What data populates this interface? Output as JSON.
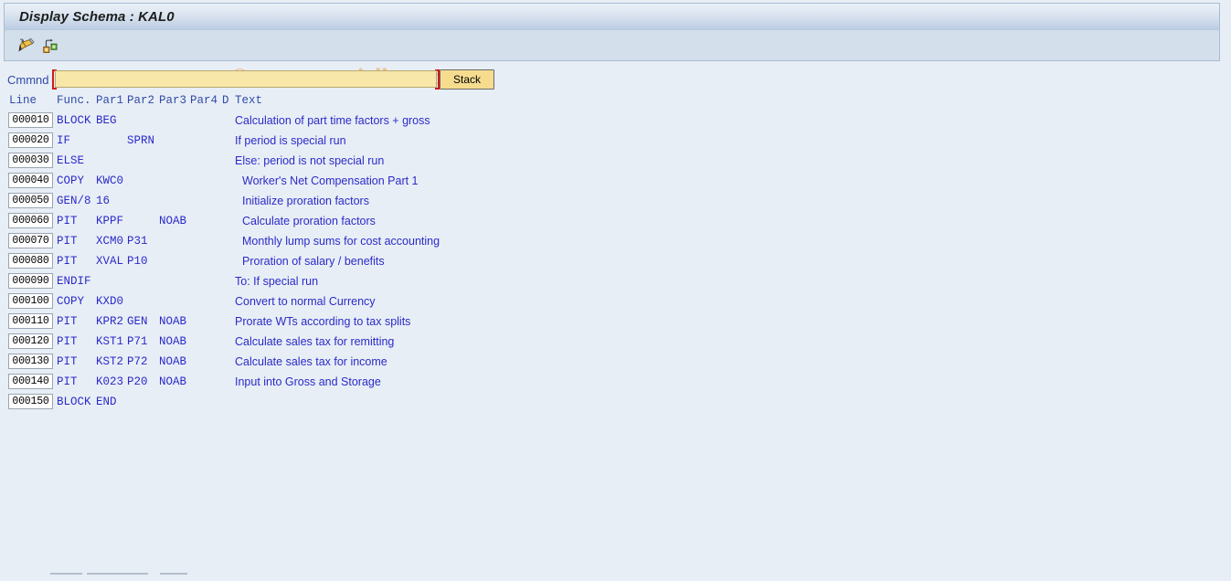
{
  "window": {
    "title": "Display Schema : KAL0"
  },
  "toolbar": {
    "buttons": [
      {
        "name": "edit-icon",
        "tooltip": "Change"
      },
      {
        "name": "structure-icon",
        "tooltip": "Structure"
      }
    ]
  },
  "watermark": {
    "text": "© www.tutorialkart.com",
    "color": "#eec192"
  },
  "command": {
    "label": "Cmmnd",
    "value": "",
    "placeholder": "",
    "stack_label": "Stack"
  },
  "table": {
    "headers": {
      "line": "Line",
      "func": "Func.",
      "par1": "Par1",
      "par2": "Par2",
      "par3": "Par3",
      "par4": "Par4",
      "d": "D",
      "text": "Text"
    },
    "rows": [
      {
        "line": "000010",
        "func": "BLOCK",
        "par1": "BEG",
        "par2": "",
        "par3": "",
        "par4": "",
        "d": "",
        "text": "Calculation of part time factors + gross",
        "indent": 0
      },
      {
        "line": "000020",
        "func": "IF",
        "par1": "",
        "par2": "SPRN",
        "par3": "",
        "par4": "",
        "d": "",
        "text": "If period is special run",
        "indent": 0
      },
      {
        "line": "000030",
        "func": "ELSE",
        "par1": "",
        "par2": "",
        "par3": "",
        "par4": "",
        "d": "",
        "text": "Else: period is not special run",
        "indent": 0
      },
      {
        "line": "000040",
        "func": "COPY",
        "par1": "KWC0",
        "par2": "",
        "par3": "",
        "par4": "",
        "d": "",
        "text": "Worker's Net Compensation Part 1",
        "indent": 1
      },
      {
        "line": "000050",
        "func": "GEN/8",
        "par1": "16",
        "par2": "",
        "par3": "",
        "par4": "",
        "d": "",
        "text": "Initialize proration factors",
        "indent": 1
      },
      {
        "line": "000060",
        "func": "PIT",
        "par1": "KPPF",
        "par2": "",
        "par3": "NOAB",
        "par4": "",
        "d": "",
        "text": "Calculate proration factors",
        "indent": 1
      },
      {
        "line": "000070",
        "func": "PIT",
        "par1": "XCM0",
        "par2": "P31",
        "par3": "",
        "par4": "",
        "d": "",
        "text": "Monthly lump sums for cost accounting",
        "indent": 1
      },
      {
        "line": "000080",
        "func": "PIT",
        "par1": "XVAL",
        "par2": "P10",
        "par3": "",
        "par4": "",
        "d": "",
        "text": "Proration of salary / benefits",
        "indent": 1
      },
      {
        "line": "000090",
        "func": "ENDIF",
        "par1": "",
        "par2": "",
        "par3": "",
        "par4": "",
        "d": "",
        "text": "To: If special run",
        "indent": 0
      },
      {
        "line": "000100",
        "func": "COPY",
        "par1": "KXD0",
        "par2": "",
        "par3": "",
        "par4": "",
        "d": "",
        "text": "Convert to normal Currency",
        "indent": 0
      },
      {
        "line": "000110",
        "func": "PIT",
        "par1": "KPR2",
        "par2": "GEN",
        "par3": "NOAB",
        "par4": "",
        "d": "",
        "text": "Prorate WTs according to tax splits",
        "indent": 0
      },
      {
        "line": "000120",
        "func": "PIT",
        "par1": "KST1",
        "par2": "P71",
        "par3": "NOAB",
        "par4": "",
        "d": "",
        "text": "Calculate sales tax for remitting",
        "indent": 0
      },
      {
        "line": "000130",
        "func": "PIT",
        "par1": "KST2",
        "par2": "P72",
        "par3": "NOAB",
        "par4": "",
        "d": "",
        "text": "Calculate sales tax for income",
        "indent": 0
      },
      {
        "line": "000140",
        "func": "PIT",
        "par1": "K023",
        "par2": "P20",
        "par3": "NOAB",
        "par4": "",
        "d": "",
        "text": "Input into Gross and Storage",
        "indent": 0
      },
      {
        "line": "000150",
        "func": "BLOCK",
        "par1": "END",
        "par2": "",
        "par3": "",
        "par4": "",
        "d": "",
        "text": "",
        "indent": 0
      }
    ]
  },
  "colors": {
    "page_background": "#e8eef6",
    "title_bar": "#c3d3e5",
    "toolbar": "#d3dfeb",
    "text_blue": "#2b2bc8",
    "label_blue": "#2f4ba8",
    "input_yellow": "#f7e7a8",
    "required_marker": "#d01a1a"
  }
}
